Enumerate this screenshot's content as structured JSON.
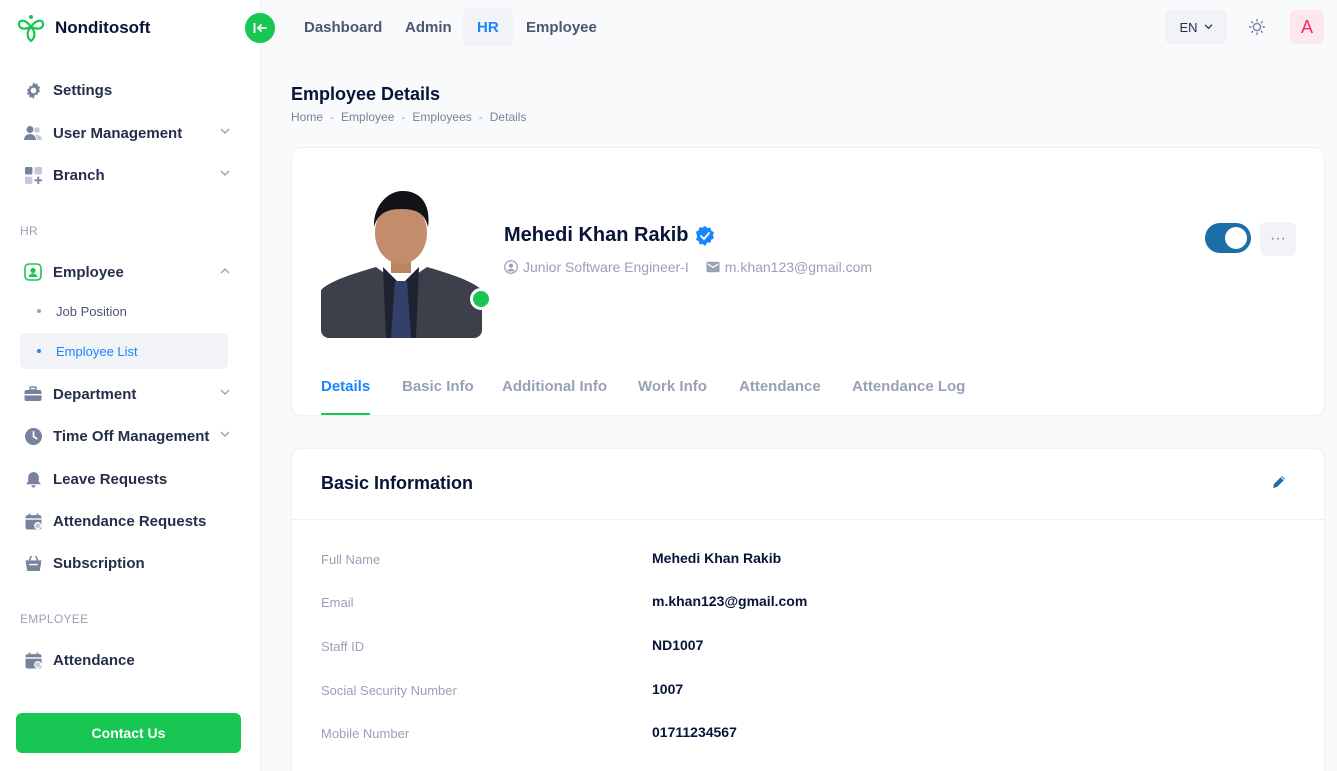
{
  "app": {
    "name": "Nonditosoft"
  },
  "sidebar": {
    "items": [
      {
        "label": "Settings",
        "icon": "gear-icon"
      },
      {
        "label": "User Management",
        "icon": "users-icon"
      },
      {
        "label": "Branch",
        "icon": "grid-icon"
      },
      {
        "label": "Employee",
        "icon": "user-square-icon"
      },
      {
        "label": "Department",
        "icon": "briefcase-icon"
      },
      {
        "label": "Time Off Management",
        "icon": "clock-icon"
      },
      {
        "label": "Leave Requests",
        "icon": "bell-icon"
      },
      {
        "label": "Attendance Requests",
        "icon": "calendar-icon"
      },
      {
        "label": "Subscription",
        "icon": "basket-icon"
      },
      {
        "label": "Attendance",
        "icon": "calendar-icon"
      }
    ],
    "sections": {
      "hr": "HR",
      "employee": "EMPLOYEE"
    },
    "sub_items": [
      {
        "label": "Job Position"
      },
      {
        "label": "Employee List"
      }
    ],
    "contact_label": "Contact Us"
  },
  "header": {
    "nav": [
      "Dashboard",
      "Admin",
      "HR",
      "Employee"
    ],
    "active_nav": "HR",
    "language": "EN",
    "avatar_letter": "A"
  },
  "page": {
    "title": "Employee Details",
    "breadcrumb": [
      "Home",
      "Employee",
      "Employees",
      "Details"
    ],
    "separator": "-"
  },
  "profile": {
    "name": "Mehedi Khan Rakib",
    "position": "Junior Software Engineer-I",
    "email": "m.khan123@gmail.com",
    "status_active": true,
    "more": "···",
    "tabs": [
      "Details",
      "Basic Info",
      "Additional Info",
      "Work Info",
      "Attendance",
      "Attendance Log"
    ],
    "active_tab": "Details"
  },
  "basic_info": {
    "title": "Basic Information",
    "rows": [
      {
        "label": "Full Name",
        "value": "Mehedi Khan Rakib"
      },
      {
        "label": "Email",
        "value": "m.khan123@gmail.com"
      },
      {
        "label": "Staff ID",
        "value": "ND1007"
      },
      {
        "label": "Social Security Number",
        "value": "1007"
      },
      {
        "label": "Mobile Number",
        "value": "01711234567"
      }
    ]
  },
  "colors": {
    "accent": "#1b84ff",
    "success": "#17c653",
    "toggle": "#1b6ea8",
    "avatar": "#f8285a"
  }
}
